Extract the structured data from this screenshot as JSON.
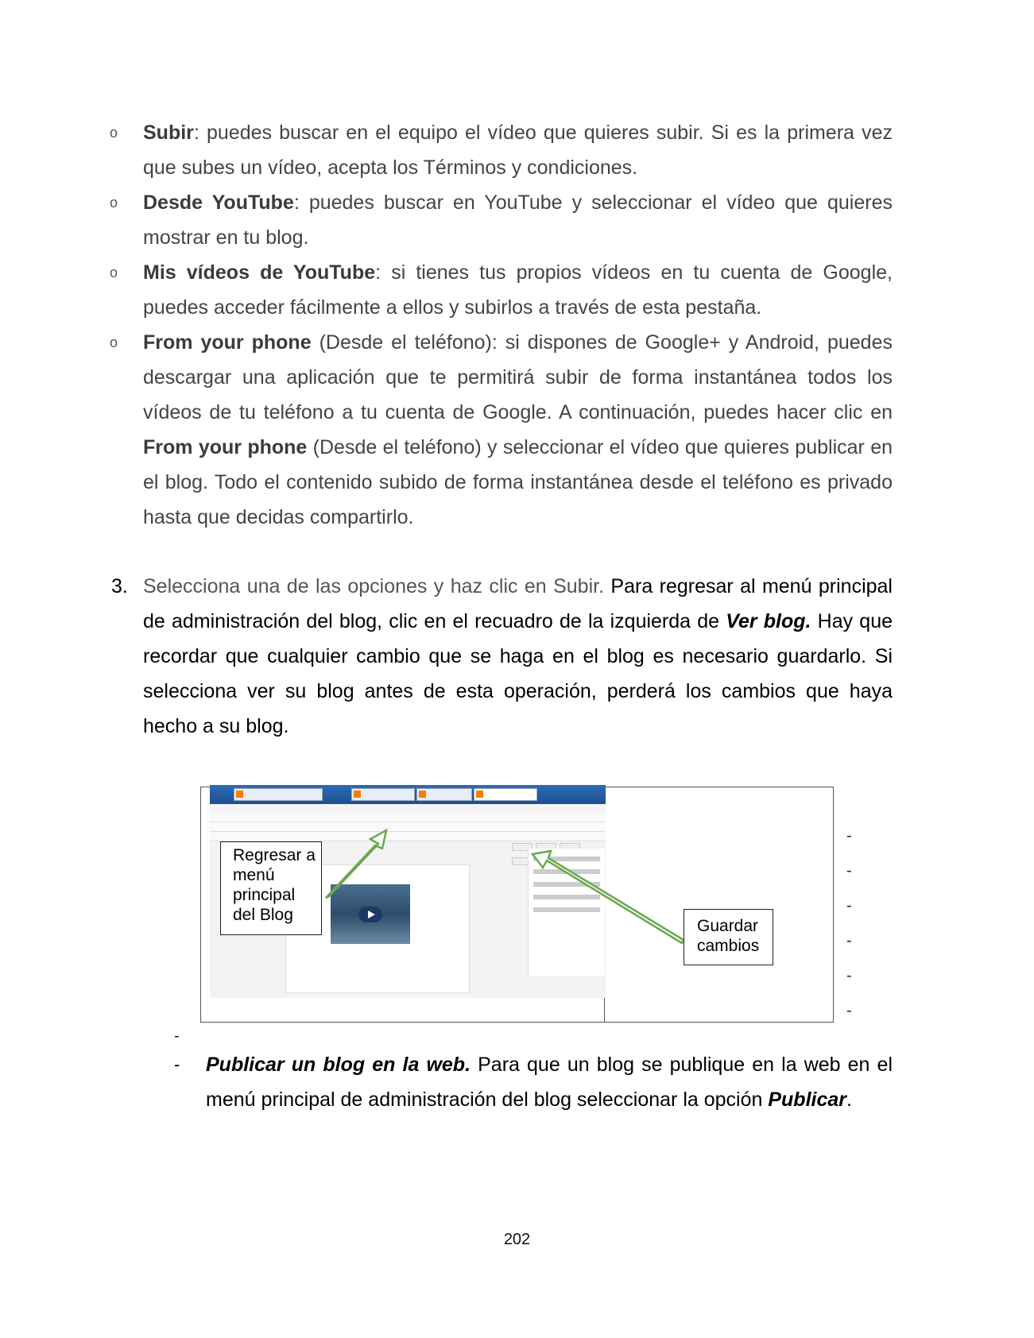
{
  "bullets": [
    {
      "term": "Subir",
      "text": ": puedes buscar en el equipo el vídeo que quieres subir. Si es la primera vez que subes un vídeo, acepta los Términos y condiciones."
    },
    {
      "term": "Desde YouTube",
      "text": ": puedes buscar en YouTube y seleccionar el vídeo que quieres mostrar en tu blog."
    },
    {
      "term": "Mis vídeos de YouTube",
      "text": ": si tienes tus propios vídeos en tu cuenta de Google, puedes acceder fácilmente a ellos y subirlos a través de esta pestaña."
    },
    {
      "term": "From your phone",
      "text": " (Desde el teléfono): si dispones de Google+ y Android, puedes descargar una aplicación que te permitirá subir de forma instantánea todos los vídeos de tu teléfono a tu cuenta de Google. A continuación, puedes hacer clic en ",
      "term2": "From your phone",
      "text2": " (Desde el teléfono) y seleccionar el vídeo que quieres publicar en el blog. Todo el contenido subido de forma instantánea desde el teléfono es privado hasta que decidas compartirlo."
    }
  ],
  "bullet_marker": "o",
  "step3": {
    "number": "3.",
    "gray_text": "Selecciona una de las opciones y haz clic en Subir.",
    "text_a": " Para regresar al menú principal de administración del blog, clic en el recuadro de la izquierda de ",
    "emphasis": "Ver blog.",
    "text_b": " Hay que recordar que cualquier cambio que se haga en el blog es necesario guardarlo. Si selecciona ver su blog antes de esta operación, perderá los cambios que haya hecho a su blog."
  },
  "figure": {
    "callout_left": "Regresar a menú principal del Blog",
    "callout_right": "Guardar cambios",
    "arrow_color": "#6aa84f"
  },
  "dash": "-",
  "publish": {
    "emphasis": "Publicar un blog en la web.",
    "text": " Para que un blog se publique en la web en el menú principal de administración del blog seleccionar la opción ",
    "emphasis2": "Publicar",
    "end": "."
  },
  "page_number": "202"
}
